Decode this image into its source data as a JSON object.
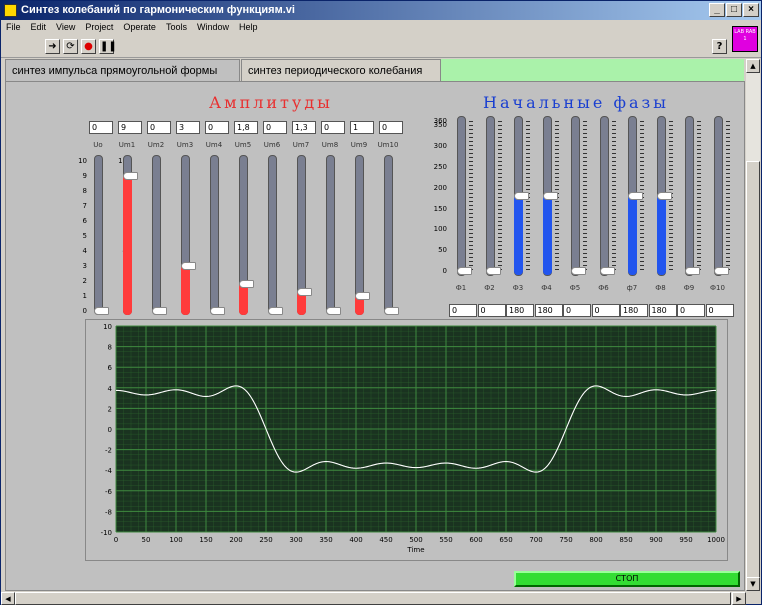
{
  "window": {
    "title": "Синтез колебаний по гармоническим функциям.vi"
  },
  "menu": [
    "File",
    "Edit",
    "View",
    "Project",
    "Operate",
    "Tools",
    "Window",
    "Help"
  ],
  "lab_icon": "LAB RAB 1",
  "tabs": [
    {
      "label": "синтез импульса прямоугольной формы"
    },
    {
      "label": "синтез периодического колебания"
    }
  ],
  "amplitudes": {
    "title": "Амплитуды",
    "scale": [
      "10",
      "9",
      "8",
      "7",
      "6",
      "5",
      "4",
      "3",
      "2",
      "1",
      "0"
    ],
    "scale_max": 10,
    "channels": [
      {
        "label": "Uo",
        "value_text": "0",
        "value": 0
      },
      {
        "label": "Um1",
        "value_text": "9",
        "value": 9
      },
      {
        "label": "Um2",
        "value_text": "0",
        "value": 0
      },
      {
        "label": "Um3",
        "value_text": "3",
        "value": 3
      },
      {
        "label": "Um4",
        "value_text": "0",
        "value": 0
      },
      {
        "label": "Um5",
        "value_text": "1,8",
        "value": 1.8
      },
      {
        "label": "Um6",
        "value_text": "0",
        "value": 0
      },
      {
        "label": "Um7",
        "value_text": "1,3",
        "value": 1.3
      },
      {
        "label": "Um8",
        "value_text": "0",
        "value": 0
      },
      {
        "label": "Um9",
        "value_text": "1",
        "value": 1
      },
      {
        "label": "Um10",
        "value_text": "0",
        "value": 0
      }
    ],
    "fill_color": "#ff3b3b"
  },
  "phases": {
    "title": "Начальные фазы",
    "scale": [
      "360",
      "350",
      "300",
      "250",
      "200",
      "150",
      "100",
      "50",
      "0"
    ],
    "scale_max": 360,
    "channels": [
      {
        "label": "Ф1",
        "value_text": "0",
        "value": 0
      },
      {
        "label": "Ф2",
        "value_text": "0",
        "value": 0
      },
      {
        "label": "Ф3",
        "value_text": "180",
        "value": 180
      },
      {
        "label": "Ф4",
        "value_text": "180",
        "value": 180
      },
      {
        "label": "Ф5",
        "value_text": "0",
        "value": 0
      },
      {
        "label": "Ф6",
        "value_text": "0",
        "value": 0
      },
      {
        "label": "ф7",
        "value_text": "180",
        "value": 180
      },
      {
        "label": "Ф8",
        "value_text": "180",
        "value": 180
      },
      {
        "label": "Ф9",
        "value_text": "0",
        "value": 0
      },
      {
        "label": "Ф10",
        "value_text": "0",
        "value": 0
      }
    ],
    "fill_color": "#2255ee"
  },
  "chart_data": {
    "type": "line",
    "xlabel": "Time",
    "xlim": [
      0,
      1000
    ],
    "ylim": [
      -10,
      10
    ],
    "xticks": [
      0,
      50,
      100,
      150,
      200,
      250,
      300,
      350,
      400,
      450,
      500,
      550,
      600,
      650,
      700,
      750,
      800,
      850,
      900,
      950,
      1000
    ],
    "yticks": [
      10,
      8,
      6,
      4,
      2,
      0,
      -2,
      -4,
      -6,
      -8,
      -10
    ],
    "grid": true,
    "background": "#1a3320",
    "grid_color": "#2e6a2e",
    "line_color": "#ffffff",
    "harmonics": [
      {
        "n": 1,
        "amplitude": 9,
        "phase_deg": 0
      },
      {
        "n": 3,
        "amplitude": 3,
        "phase_deg": 180
      },
      {
        "n": 5,
        "amplitude": 1.8,
        "phase_deg": 0
      },
      {
        "n": 7,
        "amplitude": 1.3,
        "phase_deg": 180
      },
      {
        "n": 9,
        "amplitude": 1,
        "phase_deg": 0
      }
    ]
  },
  "stop_button": {
    "label": "СТОП",
    "color": "#33dd33"
  }
}
